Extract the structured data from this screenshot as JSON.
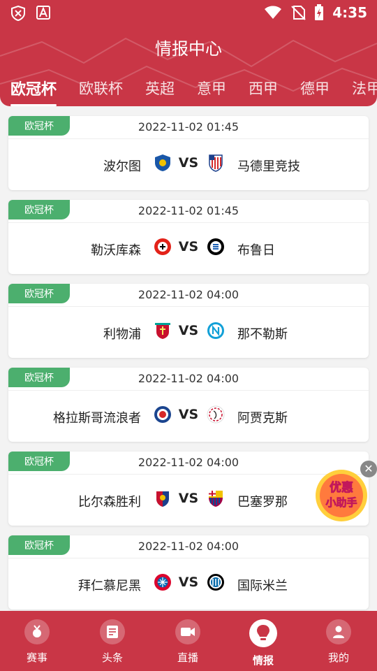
{
  "status_bar": {
    "time": "4:35"
  },
  "header": {
    "title": "情报中心"
  },
  "tabs": [
    {
      "label": "欧冠杯",
      "active": true
    },
    {
      "label": "欧联杯"
    },
    {
      "label": "英超"
    },
    {
      "label": "意甲"
    },
    {
      "label": "西甲"
    },
    {
      "label": "德甲"
    },
    {
      "label": "法甲"
    }
  ],
  "matches": [
    {
      "league": "欧冠杯",
      "datetime": "2022-11-02 01:45",
      "home": "波尔图",
      "away": "马德里竞技",
      "vs": "VS",
      "home_logo": "porto-crest-icon",
      "away_logo": "atletico-crest-icon"
    },
    {
      "league": "欧冠杯",
      "datetime": "2022-11-02 01:45",
      "home": "勒沃库森",
      "away": "布鲁日",
      "vs": "VS",
      "home_logo": "leverkusen-crest-icon",
      "away_logo": "brugge-crest-icon"
    },
    {
      "league": "欧冠杯",
      "datetime": "2022-11-02 04:00",
      "home": "利物浦",
      "away": "那不勒斯",
      "vs": "VS",
      "home_logo": "liverpool-crest-icon",
      "away_logo": "napoli-crest-icon"
    },
    {
      "league": "欧冠杯",
      "datetime": "2022-11-02 04:00",
      "home": "格拉斯哥流浪者",
      "away": "阿贾克斯",
      "vs": "VS",
      "home_logo": "rangers-crest-icon",
      "away_logo": "ajax-crest-icon"
    },
    {
      "league": "欧冠杯",
      "datetime": "2022-11-02 04:00",
      "home": "比尔森胜利",
      "away": "巴塞罗那",
      "vs": "VS",
      "home_logo": "plzen-crest-icon",
      "away_logo": "barcelona-crest-icon"
    },
    {
      "league": "欧冠杯",
      "datetime": "2022-11-02 04:00",
      "home": "拜仁慕尼黑",
      "away": "国际米兰",
      "vs": "VS",
      "home_logo": "bayern-crest-icon",
      "away_logo": "inter-crest-icon"
    }
  ],
  "promo": {
    "line1": "优惠",
    "line2": "小助手",
    "close": "✕"
  },
  "bottom_nav": [
    {
      "label": "赛事",
      "icon": "medal-icon"
    },
    {
      "label": "头条",
      "icon": "news-icon"
    },
    {
      "label": "直播",
      "icon": "video-icon"
    },
    {
      "label": "情报",
      "icon": "bulb-icon",
      "active": true
    },
    {
      "label": "我的",
      "icon": "user-icon"
    }
  ],
  "colors": {
    "primary": "#c93646",
    "badge": "#4caf6e",
    "background": "#f3f3f3"
  }
}
